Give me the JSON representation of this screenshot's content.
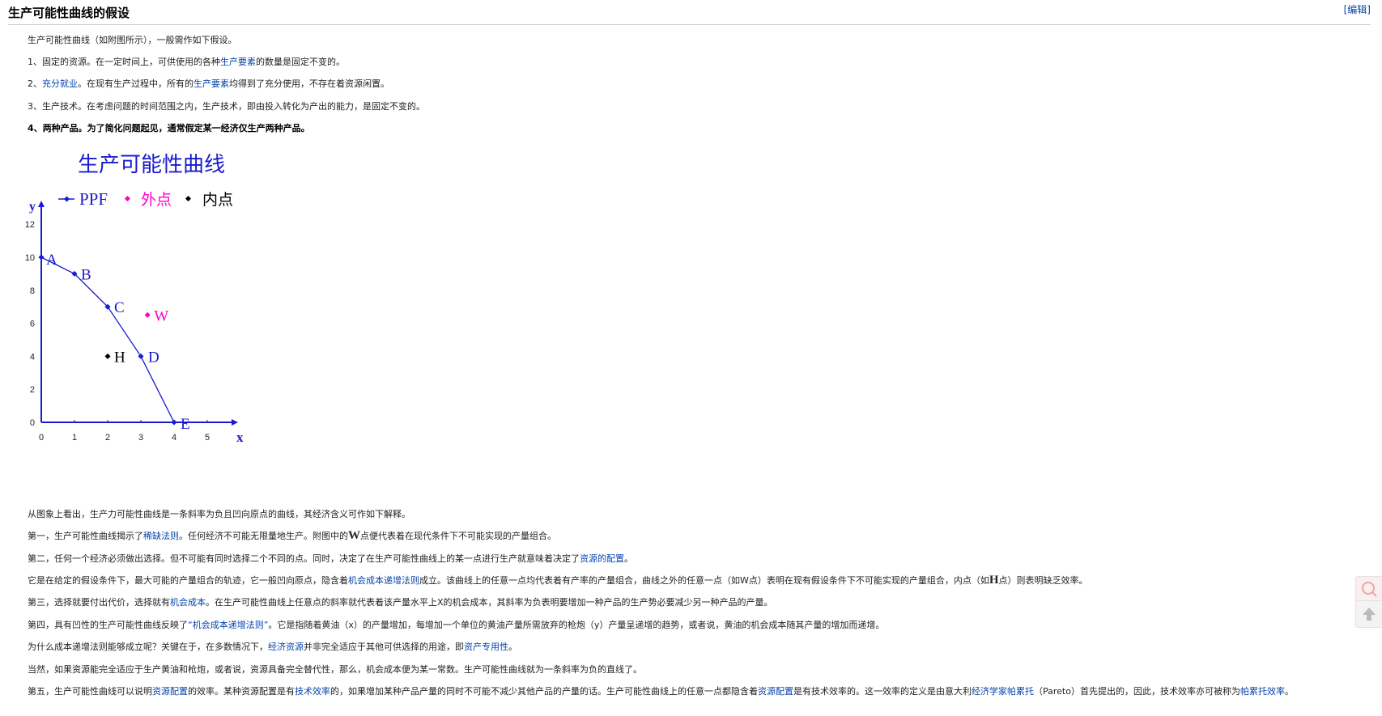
{
  "section": {
    "title": "生产可能性曲线的假设",
    "edit_label": "[编辑]"
  },
  "paras": {
    "p0": "生产可能性曲线（如附图所示），一般需作如下假设。",
    "p1": {
      "a": "1、固定的资源。在一定时间上，可供使用的各种",
      "link1": "生产要素",
      "b": "的数量是固定不变的。"
    },
    "p2": {
      "a": "2、",
      "link1": "充分就业",
      "b": "。在现有生产过程中，所有的",
      "link2": "生产要素",
      "c": "均得到了充分使用，不存在着资源闲置。"
    },
    "p3": "3、生产技术。在考虑问题的时间范围之内，生产技术，即由投入转化为产出的能力，是固定不变的。",
    "p4": "4、两种产品。为了简化问题起见，通常假定某一经济仅生产两种产品。",
    "p5": "从图象上看出，生产力可能性曲线是一条斜率为负且凹向原点的曲线，其经济含义可作如下解释。",
    "p6": {
      "a": "第一，生产可能性曲线揭示了",
      "link1": "稀缺法则",
      "b": "。任何经济不可能无限量地生产。附图中的",
      "big": "W",
      "c": "点便代表着在现代条件下不可能实现的产量组合。"
    },
    "p7": {
      "a": "第二，任何一个经济必须做出选择。但不可能有同时选择二个不同的点。同时，决定了在生产可能性曲线上的某一点进行生产就意味着决定了",
      "link1": "资源的配置",
      "b": "。"
    },
    "p8": {
      "a": "它是在给定的假设条件下，最大可能的产量组合的轨迹，它一般凹向原点，隐含着",
      "link1": "机会成本递增法则",
      "b": "成立。该曲线上的任意一点均代表着有产率的产量组合，曲线之外的任意一点（如W点）表明在现有假设条件下不可能实现的产量组合，内点（如",
      "big": "H",
      "c": "点）则表明缺乏效率。"
    },
    "p9": {
      "a": "第三，选择就要付出代价，选择就有",
      "link1": "机会成本",
      "b": "。在生产可能性曲线上任意点的斜率就代表着该产量水平上X的机会成本，其斜率为负表明要增加一种产品的生产势必要减少另一种产品的产量。"
    },
    "p10": {
      "a": "第四，具有凹性的生产可能性曲线反映了",
      "link1": "“机会成本递增法则”",
      "b": "。它是指随着黄油（x）的产量增加，每增加一个单位的黄油产量所需放弃的枪炮（y）产量呈递增的趋势，或者说，黄油的机会成本随其产量的增加而递增。"
    },
    "p11": {
      "a": "为什么成本递增法则能够成立呢？关键在于，在多数情况下，",
      "link1": "经济资源",
      "b": "并非完全适应于其他可供选择的用途，即",
      "link2": "资产专用性",
      "c": "。"
    },
    "p12": "当然，如果资源能完全适应于生产黄油和枪炮，或者说，资源具备完全替代性，那么，机会成本便为某一常数。生产可能性曲线就为一条斜率为负的直线了。",
    "p13": {
      "a": "第五，生产可能性曲线可以说明",
      "link1": "资源配置",
      "b": "的效率。某种资源配置是有",
      "link2": "技术效率",
      "c": "的，如果增加某种产品产量的同时不可能不减少其他产品的产量的话。生产可能性曲线上的任意一点都隐含着",
      "link3": "资源配置",
      "d": "是有技术效率的。这一效率的定义是由意大利",
      "link4": "经济学家帕累托",
      "e": "（Pareto）首先提出的，因此，技术效率亦可被称为",
      "link5": "帕累托效率",
      "f": "。"
    }
  },
  "chart_data": {
    "type": "scatter",
    "title": "生产可能性曲线",
    "xlabel": "x",
    "ylabel": "y",
    "xlim": [
      0,
      5.8
    ],
    "ylim": [
      0,
      13
    ],
    "x_ticks": [
      "0",
      "1",
      "2",
      "3",
      "4",
      "5"
    ],
    "y_ticks": [
      "0",
      "2",
      "4",
      "6",
      "8",
      "10",
      "12"
    ],
    "legend": {
      "placement": "top",
      "entries": [
        "PPF",
        "外点",
        "内点"
      ]
    },
    "series": [
      {
        "name": "PPF",
        "color": "#1a1ad0",
        "points": [
          {
            "label": "A",
            "x": 0,
            "y": 10
          },
          {
            "label": "B",
            "x": 1,
            "y": 9
          },
          {
            "label": "C",
            "x": 2,
            "y": 7
          },
          {
            "label": "D",
            "x": 3,
            "y": 4
          },
          {
            "label": "E",
            "x": 4,
            "y": 0
          }
        ]
      },
      {
        "name": "外点",
        "color": "#ff00cc",
        "points": [
          {
            "label": "W",
            "x": 3.2,
            "y": 6.5
          }
        ]
      },
      {
        "name": "内点",
        "color": "#000000",
        "points": [
          {
            "label": "H",
            "x": 2,
            "y": 4
          }
        ]
      }
    ]
  }
}
